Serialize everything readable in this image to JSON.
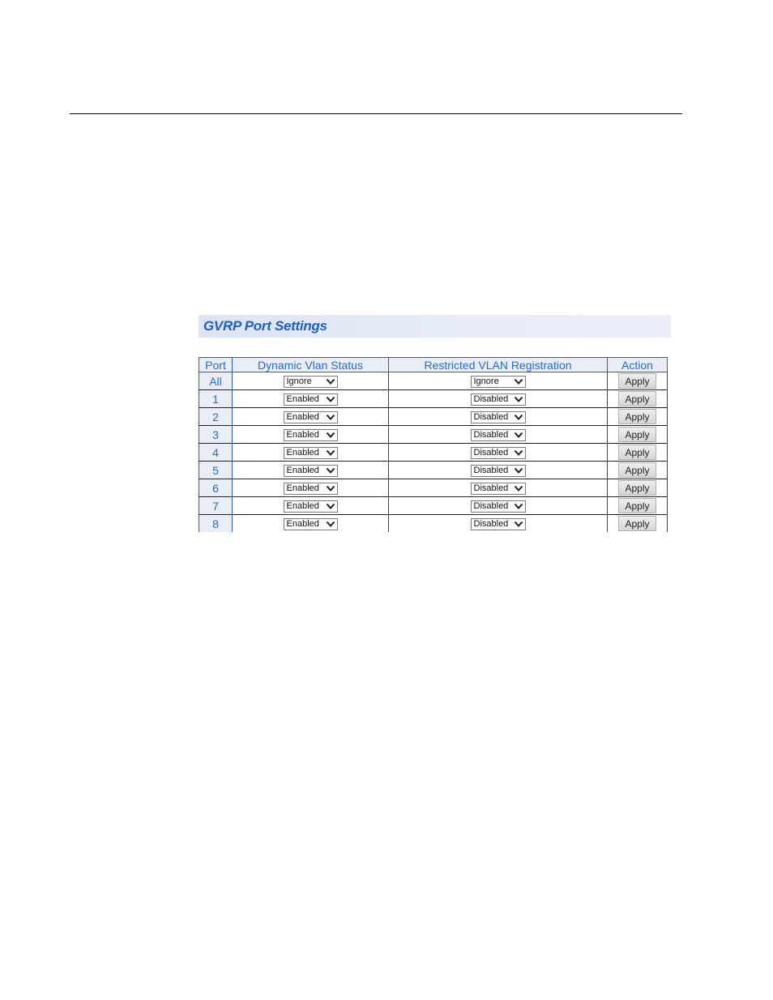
{
  "panel": {
    "title": "GVRP Port Settings"
  },
  "table": {
    "headers": [
      "Port",
      "Dynamic Vlan Status",
      "Restricted VLAN Registration",
      "Action"
    ],
    "rows": [
      {
        "port": "All",
        "dynamic_vlan_status": "Ignore",
        "restricted_vlan_registration": "Ignore",
        "action": "Apply"
      },
      {
        "port": "1",
        "dynamic_vlan_status": "Enabled",
        "restricted_vlan_registration": "Disabled",
        "action": "Apply"
      },
      {
        "port": "2",
        "dynamic_vlan_status": "Enabled",
        "restricted_vlan_registration": "Disabled",
        "action": "Apply"
      },
      {
        "port": "3",
        "dynamic_vlan_status": "Enabled",
        "restricted_vlan_registration": "Disabled",
        "action": "Apply"
      },
      {
        "port": "4",
        "dynamic_vlan_status": "Enabled",
        "restricted_vlan_registration": "Disabled",
        "action": "Apply"
      },
      {
        "port": "5",
        "dynamic_vlan_status": "Enabled",
        "restricted_vlan_registration": "Disabled",
        "action": "Apply"
      },
      {
        "port": "6",
        "dynamic_vlan_status": "Enabled",
        "restricted_vlan_registration": "Disabled",
        "action": "Apply"
      },
      {
        "port": "7",
        "dynamic_vlan_status": "Enabled",
        "restricted_vlan_registration": "Disabled",
        "action": "Apply"
      },
      {
        "port": "8",
        "dynamic_vlan_status": "Enabled",
        "restricted_vlan_registration": "Disabled",
        "action": "Apply"
      }
    ]
  },
  "colors": {
    "title_text": "#1f5fc8",
    "header_text": "#2a6ad0",
    "header_bg": "#e8edf6",
    "border_blue": "#2b5fb5"
  }
}
